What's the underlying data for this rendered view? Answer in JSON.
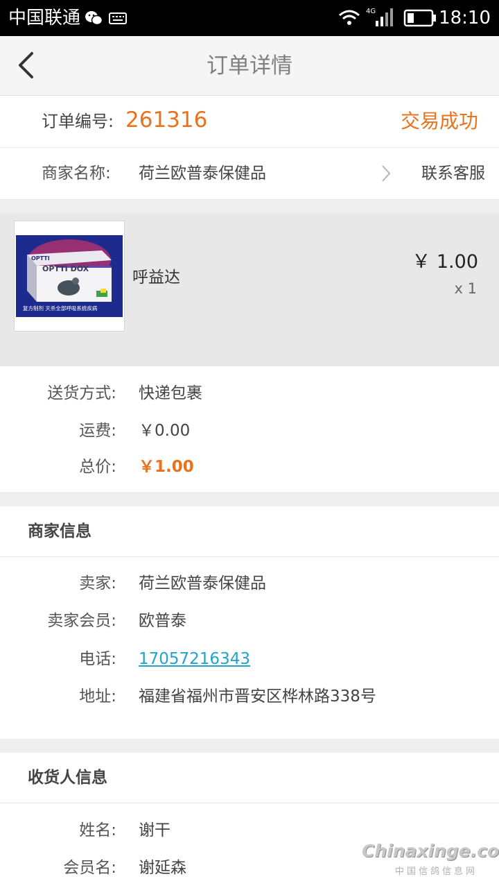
{
  "status_bar": {
    "carrier": "中国联通",
    "network": "4G",
    "time": "18:10"
  },
  "header": {
    "title": "订单详情"
  },
  "order": {
    "number_label": "订单编号:",
    "number": "261316",
    "status": "交易成功",
    "merchant_label": "商家名称:",
    "merchant_name": "荷兰欧普泰保健品",
    "contact_label": "联系客服"
  },
  "product": {
    "image_brand": "OPTTI",
    "image_title": "OPTTI DOX",
    "image_caption": "复方制剂 灭杀全部呼吸系统疾病",
    "name": "呼益达",
    "price": "￥ 1.00",
    "quantity": "x 1"
  },
  "delivery": {
    "items": [
      {
        "label": "送货方式:",
        "value": "快递包裹"
      },
      {
        "label": "运费:",
        "value": "￥0.00"
      },
      {
        "label": "总价:",
        "value": "￥1.00"
      }
    ]
  },
  "merchant_info": {
    "title": "商家信息",
    "items": [
      {
        "label": "卖家:",
        "value": "荷兰欧普泰保健品"
      },
      {
        "label": "卖家会员:",
        "value": "欧普泰"
      },
      {
        "label": "电话:",
        "value": "17057216343"
      },
      {
        "label": "地址:",
        "value": "福建省福州市晋安区桦林路338号"
      }
    ]
  },
  "consignee_info": {
    "title": "收货人信息",
    "items": [
      {
        "label": "姓名:",
        "value": "谢干"
      },
      {
        "label": "会员名:",
        "value": "谢延森"
      }
    ]
  },
  "watermark": {
    "main": "Chinaxinge.com",
    "sub": "中国信鸽信息网"
  },
  "colors": {
    "accent": "#e8731c",
    "link": "#22a3c9",
    "background": "#efefef"
  }
}
